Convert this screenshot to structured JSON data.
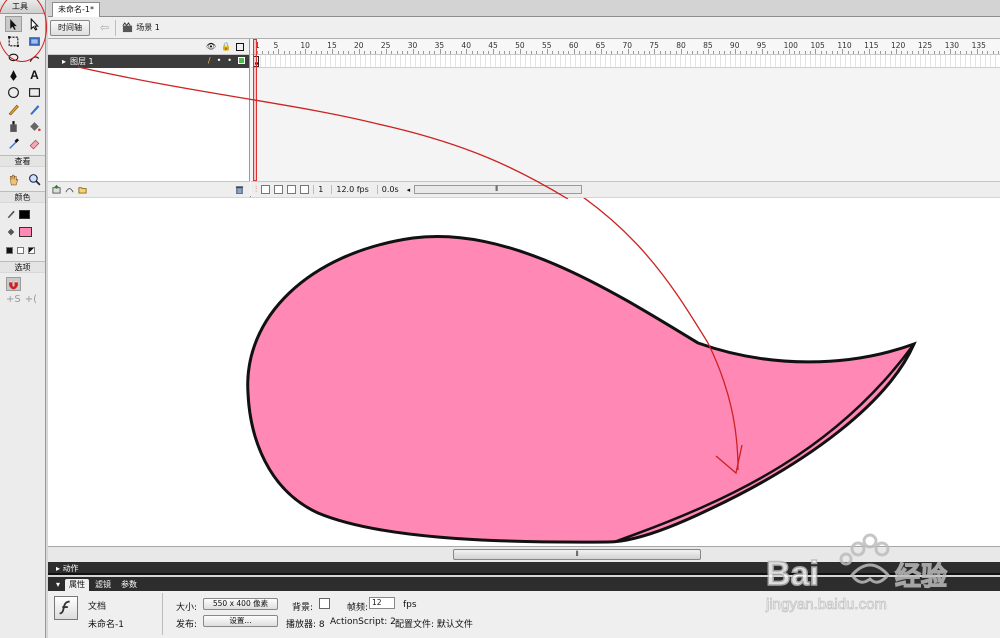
{
  "app": {
    "document_tab": "未命名-1*",
    "timeline_button": "时间轴",
    "scene_label": "场景 1"
  },
  "tools_panel": {
    "title": "工具",
    "sections": {
      "view": "查看",
      "colors": "颜色",
      "options": "选项"
    },
    "tools": [
      "selection-tool-icon",
      "subselection-tool-icon",
      "free-transform-icon",
      "gradient-transform-icon",
      "lasso-icon",
      "lasso-icon-2",
      "pen-icon",
      "text-icon",
      "oval-icon",
      "rectangle-icon",
      "pencil-icon",
      "brush-icon",
      "ink-bottle-icon",
      "paint-bucket-icon",
      "eyedropper-icon",
      "eraser-icon"
    ],
    "text_tool_glyph": "A",
    "stroke_color": "#000000",
    "fill_color": "#ff88b5"
  },
  "timeline": {
    "layer_name": "图层 1",
    "ruler_labels": [
      "1",
      "5",
      "10",
      "15",
      "20",
      "25",
      "30",
      "35",
      "40",
      "45",
      "50",
      "55",
      "60",
      "65",
      "70",
      "75",
      "80",
      "85",
      "90",
      "95",
      "100",
      "105",
      "110",
      "115",
      "120",
      "125",
      "130",
      "135"
    ],
    "current_frame": "1",
    "fps": "12.0 fps",
    "elapsed": "0.0s"
  },
  "stage": {
    "shape_fill": "#ff88b5",
    "shape_stroke": "#111111",
    "annotation_color": "#cc2222"
  },
  "panels": {
    "actions_label": "动作",
    "tabs": [
      "属性",
      "滤镜",
      "参数"
    ],
    "doc_type": "文档",
    "doc_name": "未命名-1",
    "size_label": "大小:",
    "size_value": "550 x 400 像素",
    "bg_label": "背景:",
    "framerate_label": "帧频:",
    "framerate_value": "12",
    "fps_unit": "fps",
    "publish_label": "发布:",
    "settings_button": "设置...",
    "player_label": "播放器: 8",
    "actionscript_label": "ActionScript: 2",
    "profile_label": "配置文件: 默认文件"
  },
  "watermark": {
    "brand": "Bai",
    "brand2": "经验",
    "url": "jingyan.baidu.com"
  }
}
